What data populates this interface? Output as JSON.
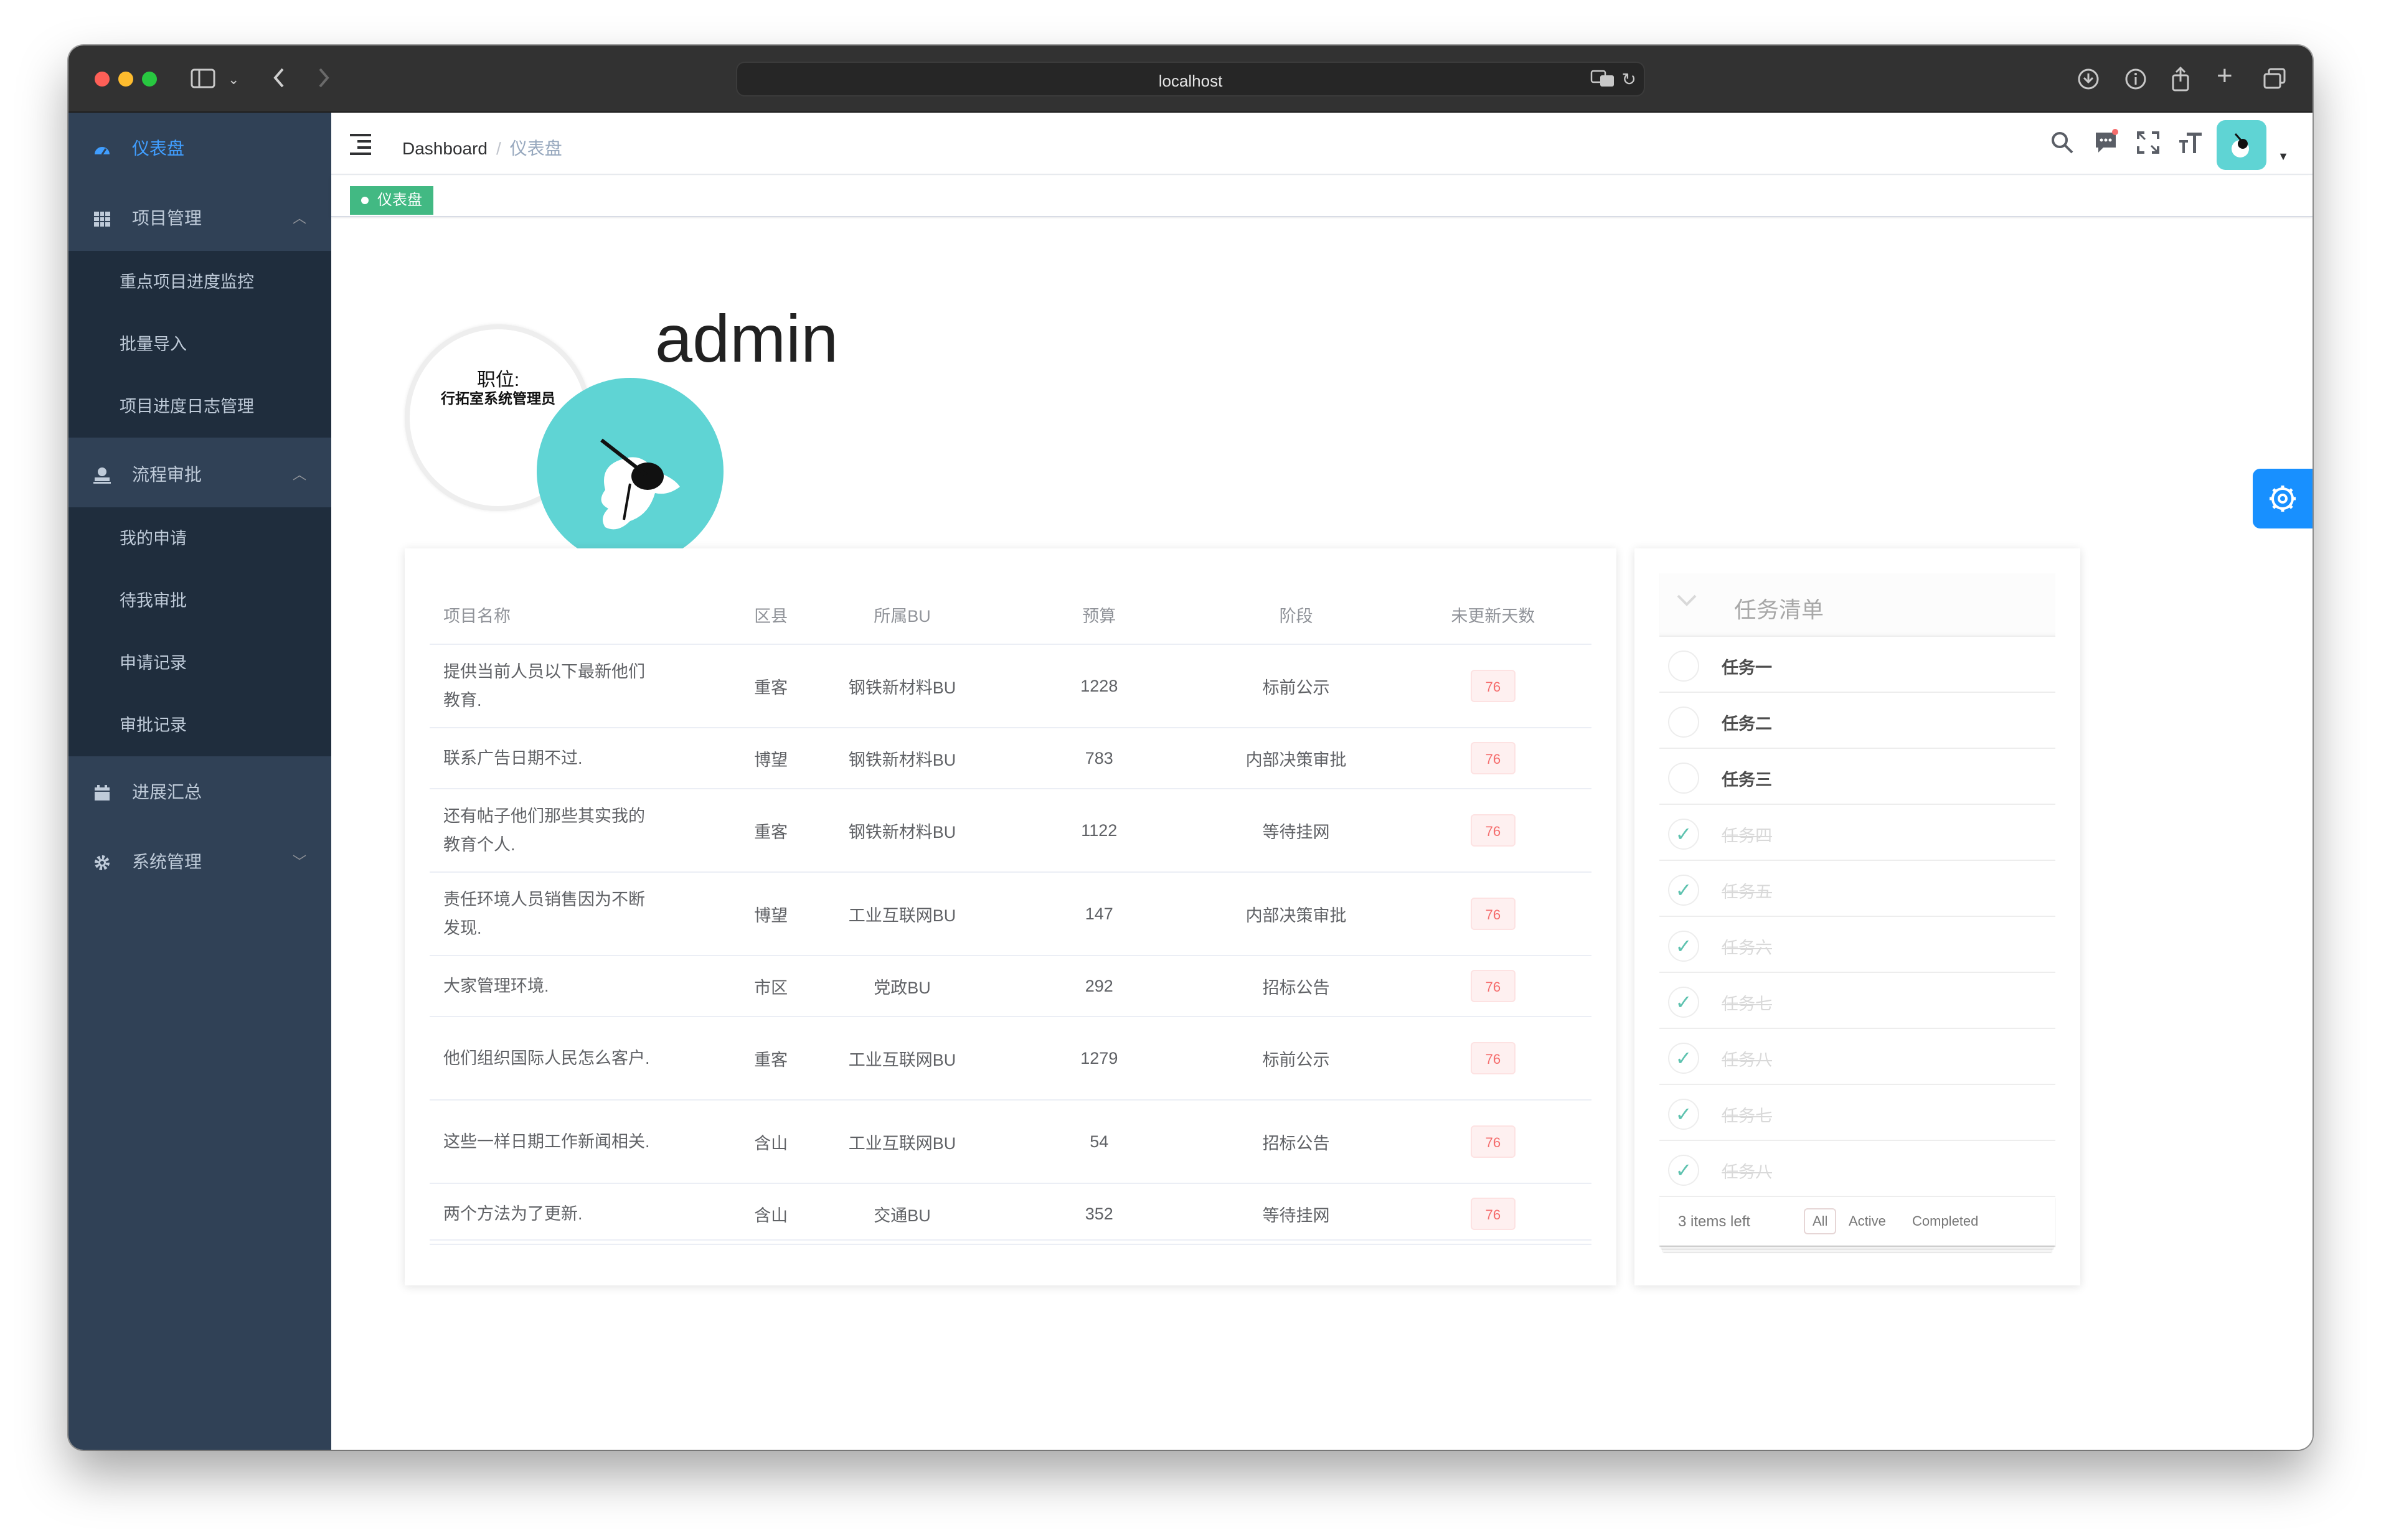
{
  "browser": {
    "address": "localhost"
  },
  "sidebar": {
    "items": [
      {
        "label": "仪表盘",
        "icon": "dashboard-icon",
        "active": true
      },
      {
        "label": "项目管理",
        "icon": "table-icon",
        "expanded": true,
        "children": [
          "重点项目进度监控",
          "批量导入",
          "项目进度日志管理"
        ]
      },
      {
        "label": "流程审批",
        "icon": "user-stamp-icon",
        "expanded": true,
        "children": [
          "我的申请",
          "待我审批",
          "申请记录",
          "审批记录"
        ]
      },
      {
        "label": "进展汇总",
        "icon": "calendar-icon"
      },
      {
        "label": "系统管理",
        "icon": "gear-icon",
        "expanded": false
      }
    ]
  },
  "navbar": {
    "breadcrumb": [
      "Dashboard",
      "仪表盘"
    ]
  },
  "tags": [
    {
      "label": "仪表盘",
      "active": true
    }
  ],
  "profile": {
    "role_title": "职位:",
    "role_name": "行拓室系统管理员",
    "username": "admin"
  },
  "table": {
    "headers": [
      "项目名称",
      "区县",
      "所属BU",
      "预算",
      "阶段",
      "未更新天数"
    ],
    "rows": [
      [
        "提供当前人员以下最新他们教育.",
        "重客",
        "钢铁新材料BU",
        "1228",
        "标前公示",
        "76"
      ],
      [
        "联系广告日期不过.",
        "博望",
        "钢铁新材料BU",
        "783",
        "内部决策审批",
        "76"
      ],
      [
        "还有帖子他们那些其实我的教育个人.",
        "重客",
        "钢铁新材料BU",
        "1122",
        "等待挂网",
        "76"
      ],
      [
        "责任环境人员销售因为不断发现.",
        "博望",
        "工业互联网BU",
        "147",
        "内部决策审批",
        "76"
      ],
      [
        "大家管理环境.",
        "市区",
        "党政BU",
        "292",
        "招标公告",
        "76"
      ],
      [
        "他们组织国际人民怎么客户.",
        "重客",
        "工业互联网BU",
        "1279",
        "标前公示",
        "76"
      ],
      [
        "这些一样日期工作新闻相关.",
        "含山",
        "工业互联网BU",
        "54",
        "招标公告",
        "76"
      ],
      [
        "两个方法为了更新.",
        "含山",
        "交通BU",
        "352",
        "等待挂网",
        "76"
      ]
    ]
  },
  "todo": {
    "title": "任务清单",
    "items": [
      {
        "label": "任务一",
        "done": false
      },
      {
        "label": "任务二",
        "done": false
      },
      {
        "label": "任务三",
        "done": false
      },
      {
        "label": "任务四",
        "done": true
      },
      {
        "label": "任务五",
        "done": true
      },
      {
        "label": "任务六",
        "done": true
      },
      {
        "label": "任务七",
        "done": true
      },
      {
        "label": "任务八",
        "done": true
      },
      {
        "label": "任务七",
        "done": true
      },
      {
        "label": "任务八",
        "done": true
      }
    ],
    "items_left": "3 items left",
    "filters": [
      "All",
      "Active",
      "Completed"
    ],
    "selected_filter": "All"
  },
  "colors": {
    "sidebar_bg": "#304156",
    "sidebar_sub_bg": "#1f2d3d",
    "active_link": "#409eff",
    "tag_green": "#42b983",
    "avatar_teal": "#5fd4d4",
    "badge_red": "#f56c6c",
    "settings_blue": "#1890ff"
  }
}
